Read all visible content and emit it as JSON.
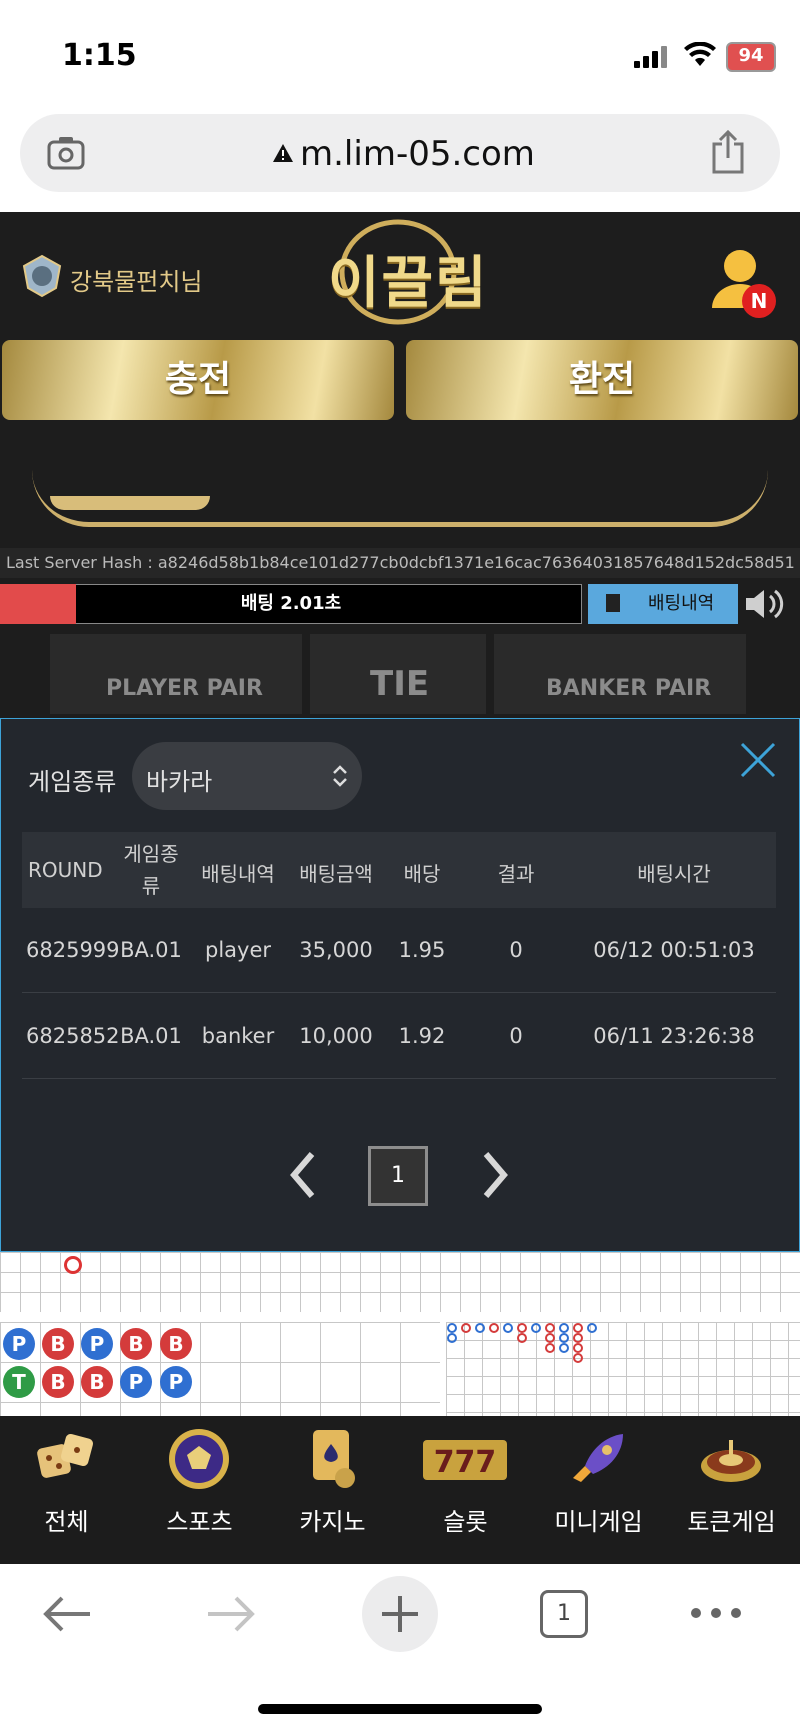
{
  "status_bar": {
    "time": "1:15",
    "battery": "94"
  },
  "browser": {
    "url": "m.lim-05.com",
    "tab_count": "1"
  },
  "header": {
    "user_name": "강북물펀치님",
    "logo": "이끌림",
    "profile_badge": "N"
  },
  "actions": {
    "deposit": "충전",
    "withdraw": "환전"
  },
  "hash_bar": {
    "text": "Last Server Hash : a8246d58b1b84ce101d277cb0dcbf1371e16cac76364031857648d152dc58d51"
  },
  "timer": {
    "label": "배팅 2.01초",
    "progress": 0.13
  },
  "history_button": "배팅내역",
  "board": {
    "player_pair": "PLAYER PAIR",
    "tie": "TIE",
    "banker_pair": "BANKER PAIR"
  },
  "modal": {
    "game_type_label": "게임종류",
    "game_type_value": "바카라",
    "columns": [
      "ROUND",
      "게임종\n류",
      "배팅내역",
      "배팅금액",
      "배당",
      "결과",
      "배팅시간"
    ],
    "rows": [
      [
        "6825999",
        "BA.01",
        "player",
        "35,000",
        "1.95",
        "0",
        "06/12 00:51:03"
      ],
      [
        "6825852",
        "BA.01",
        "banker",
        "10,000",
        "1.92",
        "0",
        "06/11 23:26:38"
      ]
    ],
    "page": "1"
  },
  "bead_road": {
    "row1": [
      "P",
      "B",
      "P",
      "B",
      "B"
    ],
    "row2": [
      "T",
      "B",
      "B",
      "P",
      "P"
    ]
  },
  "bottom_nav": [
    {
      "label": "전체",
      "icon": "dice-icon"
    },
    {
      "label": "스포츠",
      "icon": "soccer-ball-icon"
    },
    {
      "label": "카지노",
      "icon": "cards-icon"
    },
    {
      "label": "슬롯",
      "icon": "slot-777-icon"
    },
    {
      "label": "미니게임",
      "icon": "rocket-icon"
    },
    {
      "label": "토큰게임",
      "icon": "roulette-icon"
    }
  ],
  "colors": {
    "gold": "#e2c988",
    "player": "#2f6fd1",
    "banker": "#d43b3b",
    "tie": "#2f9b46",
    "accent": "#3da3d8"
  }
}
